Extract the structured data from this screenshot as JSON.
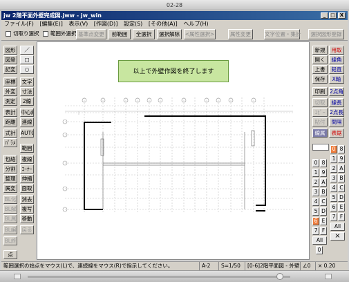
{
  "outer_title": "02-28",
  "window": {
    "title": "jw 2階平面外壁完成図.jww - jw_win",
    "btn_min": "_",
    "btn_max": "□",
    "btn_close": "X"
  },
  "menu": [
    "ファイル(F)",
    "[編集(E)]",
    "表示(V)",
    "[作図(D)]",
    "設定(S)",
    "[その他(A)]",
    "ヘルプ(H)"
  ],
  "toolbar": {
    "chk1": "切取り選択",
    "chk2": "範囲外選択",
    "b1": "基準点変更",
    "b2": "前範囲",
    "b3": "全選択",
    "b4": "選択解除",
    "b5": "<属性選択>",
    "b6": "属性変更",
    "b7": "文字位置・集計",
    "b8": "選択図形登録"
  },
  "left": {
    "r1": [
      "図形",
      "／"
    ],
    "r2": [
      "図登",
      "□"
    ],
    "r3": [
      "記変",
      "○"
    ],
    "r4": [
      "座標",
      "文字"
    ],
    "r5": [
      "外変",
      "寸法"
    ],
    "r6": [
      "測定",
      "2線"
    ],
    "r7": [
      "表計",
      "中心線"
    ],
    "r8": [
      "距離",
      "連線"
    ],
    "r9": [
      "式計",
      "AUTO"
    ],
    "r10": [
      "ﾊﾟﾗﾒ",
      ""
    ],
    "r11": [
      "",
      "範囲"
    ],
    "r12": [
      "包絡",
      "複線"
    ],
    "r13": [
      "分割",
      "ｺｰﾅｰ"
    ],
    "r14": [
      "整理",
      "伸縮"
    ],
    "r15": [
      "属変",
      "面取"
    ],
    "r16": [
      "BL化",
      "消去"
    ],
    "r17": [
      "BL解",
      "複写"
    ],
    "r18": [
      "BL属",
      "移動"
    ],
    "r19": [
      "BL編",
      "戻る"
    ],
    "r20": [
      "BL終",
      ""
    ],
    "r21": [
      "点",
      ""
    ]
  },
  "right": {
    "r1": [
      "新規",
      "用取"
    ],
    "r2": [
      "開く",
      "線角"
    ],
    "r3": [
      "上書",
      "鉛直"
    ],
    "r4": [
      "保存",
      "X軸"
    ],
    "r5": [
      "印刷",
      "2点角"
    ],
    "r6": [
      "切取",
      "線長"
    ],
    "r7": [
      "ｺﾋﾟｰ",
      "2点長"
    ],
    "r8": [
      "貼付",
      "間隔"
    ],
    "r9": [
      "線属",
      "表鋸"
    ]
  },
  "layers": {
    "left": [
      "0",
      "1",
      "2",
      "3",
      "4",
      "5",
      "6",
      "7",
      "All"
    ],
    "right": [
      "8",
      "9",
      "A",
      "B",
      "C",
      "D",
      "E",
      "F"
    ],
    "col_left": [
      "0",
      "8",
      "1",
      "9",
      "2",
      "A",
      "3",
      "B",
      "4",
      "C",
      "5",
      "D",
      "6",
      "E",
      "7",
      "F"
    ],
    "all": "All",
    "zero": "0"
  },
  "message": "以上で外壁作図を終了します",
  "status": {
    "hint": "範囲選択の始点をマウス(L)で、連続線をマウス(R)で指示してください。",
    "paper": "A-2",
    "scale": "S=1/50",
    "layer": "[0-6]2階平面図 - 外壁",
    "angle": "∠0",
    "zoom": "× 0.20"
  }
}
